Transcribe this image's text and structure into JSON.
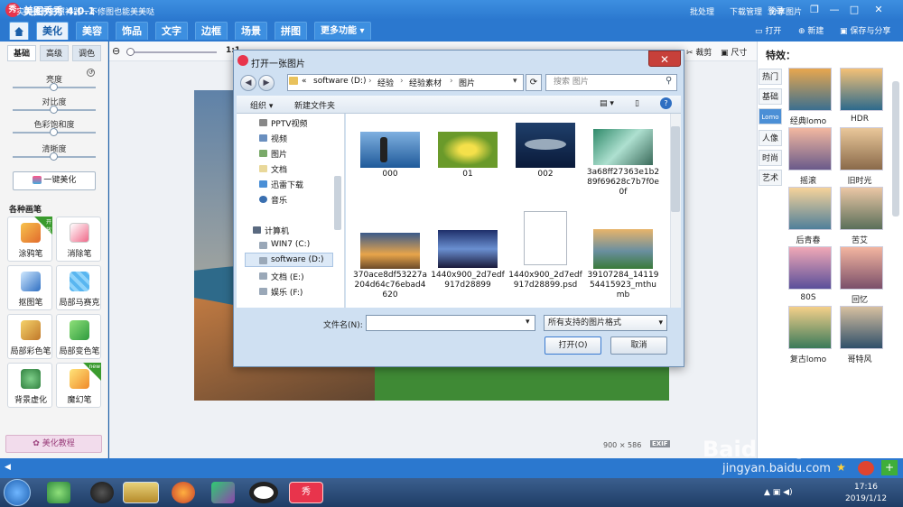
{
  "app": {
    "title": "美图秀秀 4.0.1",
    "logo": "秀",
    "login": "登录"
  },
  "window_controls": {
    "restore": "❐",
    "minimize": "—",
    "maximize": "□",
    "close": "✕"
  },
  "tabs": [
    "美化",
    "美容",
    "饰品",
    "文字",
    "边框",
    "场景",
    "拼图",
    "更多功能"
  ],
  "toolbar_actions": {
    "open": "打开",
    "new": "新建",
    "save": "保存与分享"
  },
  "left": {
    "subtabs": [
      "基础",
      "高级",
      "调色"
    ],
    "sliders": [
      {
        "label": "亮度",
        "value": 0.5
      },
      {
        "label": "对比度",
        "value": 0.5
      },
      {
        "label": "色彩饱和度",
        "value": 0.5
      },
      {
        "label": "清晰度",
        "value": 0.5
      }
    ],
    "one_key": "一键美化",
    "brushes_title": "各种画笔",
    "tools": [
      "涂鸦笔",
      "消除笔",
      "抠图笔",
      "局部马赛克",
      "局部彩色笔",
      "局部变色笔",
      "背景虚化",
      "魔幻笔"
    ],
    "badge_open": "开放",
    "badge_new": "new",
    "tutorial": "美化教程"
  },
  "workspace": {
    "zoom_label": "1:1",
    "tool_labels": [
      "裁剪",
      "尺寸"
    ],
    "dimensions": "900 × 586",
    "exif": "EXIF"
  },
  "right": {
    "title": "特效：",
    "categories": [
      "热门",
      "基础",
      "Lomo",
      "人像",
      "时尚",
      "艺术"
    ],
    "effects": [
      "经典lomo",
      "HDR",
      "摇滚",
      "旧时光",
      "后青春",
      "苦艾",
      "80S",
      "回忆",
      "复古lomo",
      "哥特风"
    ]
  },
  "statusbar": {
    "text": "实时美颜拍照神器一不修图也能美美哒",
    "actions": [
      "批处理",
      "下载管理",
      "分享图片"
    ]
  },
  "taskbar": {
    "time": "17:16",
    "date": "2019/1/12"
  },
  "watermark": {
    "brand": "Baidu经验",
    "url": "jingyan.baidu.com"
  },
  "dialog": {
    "title": "打开一张图片",
    "breadcrumb": [
      "«",
      "software (D:)",
      "经验",
      "经验素材",
      "图片"
    ],
    "search_placeholder": "搜索 图片",
    "organize": "组织 ▾",
    "new_folder": "新建文件夹",
    "tree": [
      "PPTV视频",
      "视频",
      "图片",
      "文档",
      "迅雷下载",
      "音乐",
      "计算机",
      "WIN7 (C:)",
      "software (D:)",
      "文档 (E:)",
      "娱乐 (F:)"
    ],
    "files": [
      "000",
      "01",
      "002",
      "3a68ff27363e1b289f69628c7b7f0e0f",
      "370ace8df53227a204d64c76ebad4620",
      "1440x900_2d7edf917d28899",
      "1440x900_2d7edf917d28899.psd",
      "39107284_1411954415923_mthumb"
    ],
    "filename_label": "文件名(N):",
    "filename_value": "",
    "filetype": "所有支持的图片格式",
    "open_btn": "打开(O)",
    "cancel_btn": "取消"
  }
}
